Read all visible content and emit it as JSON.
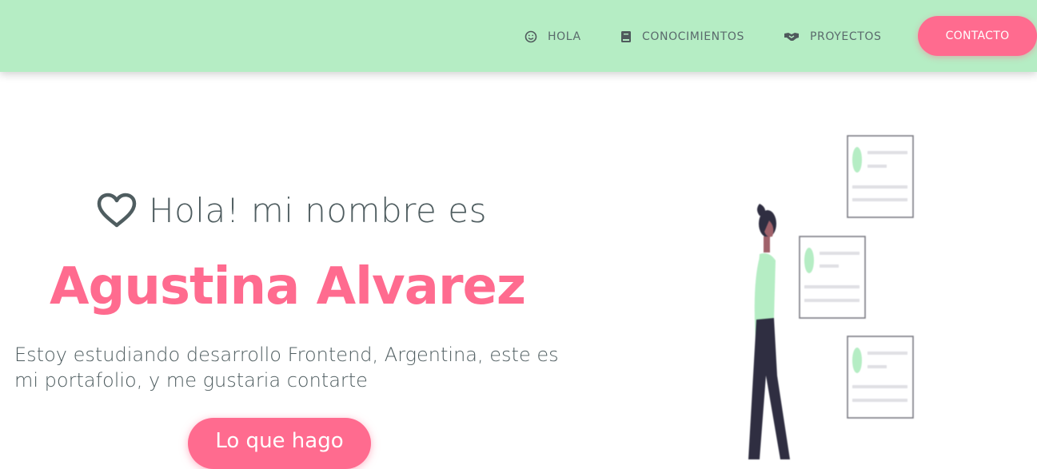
{
  "nav": {
    "items": [
      {
        "label": "HOLA",
        "icon": "smile-icon"
      },
      {
        "label": "CONOCIMIENTOS",
        "icon": "book-icon"
      },
      {
        "label": "PROYECTOS",
        "icon": "handshake-icon"
      }
    ],
    "contact_label": "CONTACTO"
  },
  "hero": {
    "greeting": "Hola! mi nombre es",
    "greeting_icon": "heart-outline-icon",
    "name": "Agustina Alvarez",
    "intro": "Estoy estudiando desarrollo Frontend, Argentina, este es mi portafolio, y me gustaria contarte",
    "cta_label": "Lo que hago",
    "illustration_icon": "person-with-cards-illustration"
  },
  "colors": {
    "navbar_bg": "#b5edc4",
    "accent": "#ff6b8f",
    "text": "#4f5d60"
  }
}
